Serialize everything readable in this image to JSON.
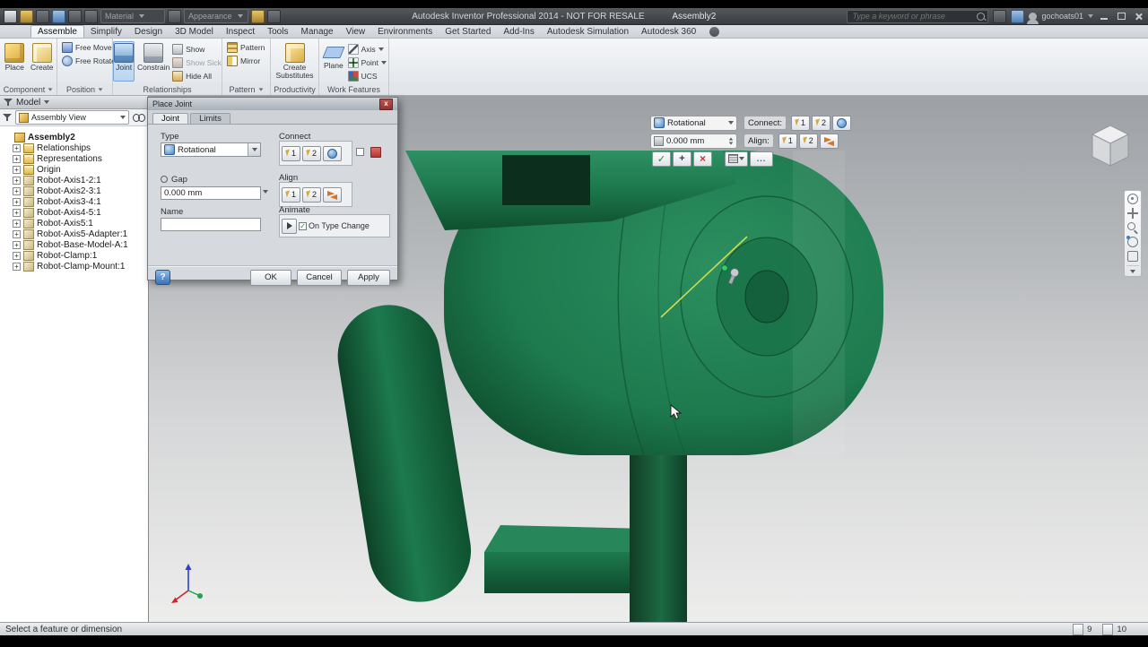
{
  "colors": {
    "robot_green": "#1d7a4e",
    "robot_green_light": "#2e9163",
    "robot_green_dark": "#0e4a2c",
    "joint_axis_yellow": "#d8e04e",
    "accent_blue": "#3f7fc0"
  },
  "titlebar": {
    "material_label": "Material",
    "appearance_label": "Appearance",
    "title": "Autodesk Inventor Professional 2014 - NOT FOR RESALE",
    "doc_name": "Assembly2",
    "search_placeholder": "Type a keyword or phrase",
    "user_name": "gochoats01"
  },
  "ribbon_tabs": [
    "Assemble",
    "Simplify",
    "Design",
    "3D Model",
    "Inspect",
    "Tools",
    "Manage",
    "View",
    "Environments",
    "Get Started",
    "Add-Ins",
    "Autodesk Simulation",
    "Autodesk 360"
  ],
  "ribbon_active_tab": "Assemble",
  "ribbon": {
    "place": "Place",
    "create": "Create",
    "free_move": "Free Move",
    "free_rotate": "Free Rotate",
    "joint": "Joint",
    "constrain": "Constrain",
    "show": "Show",
    "show_sick": "Show Sick",
    "hide_all": "Hide All",
    "pattern": "Pattern",
    "mirror": "Mirror",
    "create_substitutes": "Create Substitutes",
    "plane": "Plane",
    "axis": "Axis",
    "point": "Point",
    "ucs": "UCS"
  },
  "panels": {
    "component": "Component",
    "position": "Position",
    "relationships": "Relationships",
    "pattern": "Pattern",
    "productivity": "Productivity",
    "work_features": "Work Features"
  },
  "browser": {
    "header": "Model",
    "view_selector": "Assembly View",
    "items": [
      {
        "label": "Assembly2",
        "type": "assembly",
        "bold": true,
        "expander": ""
      },
      {
        "label": "Relationships",
        "type": "folder",
        "expander": "+"
      },
      {
        "label": "Representations",
        "type": "folder",
        "expander": "+"
      },
      {
        "label": "Origin",
        "type": "folder",
        "expander": "+"
      },
      {
        "label": "Robot-Axis1-2:1",
        "type": "part",
        "expander": "+"
      },
      {
        "label": "Robot-Axis2-3:1",
        "type": "part",
        "expander": "+"
      },
      {
        "label": "Robot-Axis3-4:1",
        "type": "part",
        "expander": "+"
      },
      {
        "label": "Robot-Axis4-5:1",
        "type": "part",
        "expander": "+"
      },
      {
        "label": "Robot-Axis5:1",
        "type": "part",
        "expander": "+"
      },
      {
        "label": "Robot-Axis5-Adapter:1",
        "type": "part",
        "expander": "+"
      },
      {
        "label": "Robot-Base-Model-A:1",
        "type": "part",
        "expander": "+"
      },
      {
        "label": "Robot-Clamp:1",
        "type": "part",
        "expander": "+"
      },
      {
        "label": "Robot-Clamp-Mount:1",
        "type": "part",
        "expander": "+"
      }
    ]
  },
  "dialog": {
    "title": "Place Joint",
    "tab_joint": "Joint",
    "tab_limits": "Limits",
    "type_label": "Type",
    "type_value": "Rotational",
    "connect_label": "Connect",
    "connect_btn1": "1",
    "connect_btn2": "2",
    "gap_label": "Gap",
    "gap_value": "0.000 mm",
    "align_label": "Align",
    "align_btn1": "1",
    "align_btn2": "2",
    "name_label": "Name",
    "name_value": "",
    "animate_label": "Animate",
    "animate_checkbox": "On Type Change",
    "animate_check_glyph": "✓",
    "help": "?",
    "ok": "OK",
    "cancel": "Cancel",
    "apply": "Apply"
  },
  "mini_toolbar": {
    "type_value": "Rotational",
    "connect_label": "Connect:",
    "connect_btn1": "1",
    "connect_btn2": "2",
    "offset_value": "0.000 mm",
    "align_label": "Align:",
    "align_btn1": "1",
    "align_btn2": "2",
    "apply_symbol": "✓",
    "add_symbol": "+",
    "cancel_symbol": "×",
    "more_label": "..."
  },
  "statusbar": {
    "message": "Select a feature or dimension",
    "count1": "9",
    "count2": "10"
  }
}
